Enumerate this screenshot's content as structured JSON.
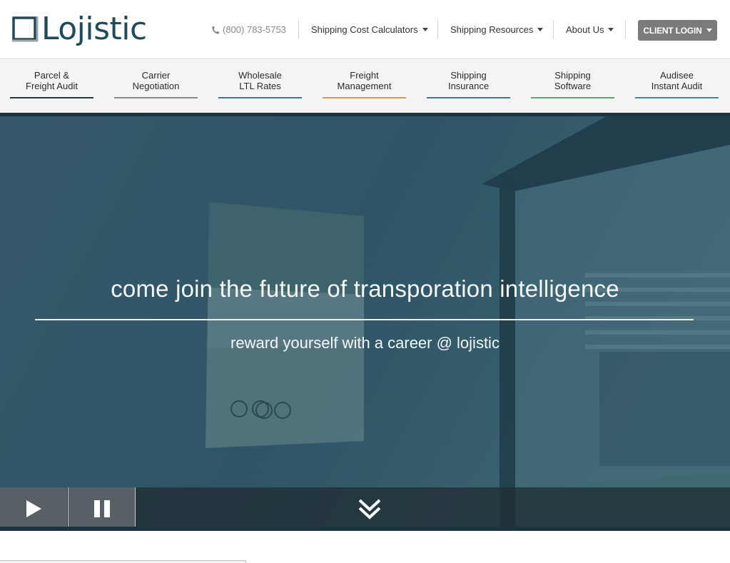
{
  "brand": {
    "logo_text": "Lojistic"
  },
  "header": {
    "phone": "(800) 783-5753",
    "nav": [
      {
        "label": "Shipping Cost Calculators"
      },
      {
        "label": "Shipping Resources"
      },
      {
        "label": "About Us"
      }
    ],
    "login_label": "CLIENT LOGIN"
  },
  "services": [
    {
      "line1": "Parcel &",
      "line2": "Freight Audit",
      "color": "#1c3a4a"
    },
    {
      "line1": "Carrier",
      "line2": "Negotiation",
      "color": "#8c8c8c"
    },
    {
      "line1": "Wholesale",
      "line2": "LTL Rates",
      "color": "#2f7d96"
    },
    {
      "line1": "Freight",
      "line2": "Management",
      "color": "#e8963a"
    },
    {
      "line1": "Shipping",
      "line2": "Insurance",
      "color": "#2f7d96"
    },
    {
      "line1": "Shipping",
      "line2": "Software",
      "color": "#3fb36a"
    },
    {
      "line1": "Audisee",
      "line2": "Instant Audit",
      "color": "#2f8fb0"
    }
  ],
  "hero": {
    "title": "come join the future of transporation intelligence",
    "subtitle": "reward yourself with a career @ lojistic"
  },
  "icons": {
    "phone": "phone-icon",
    "play": "play-icon",
    "pause": "pause-icon",
    "scroll_down": "double-chevron-down-icon"
  }
}
